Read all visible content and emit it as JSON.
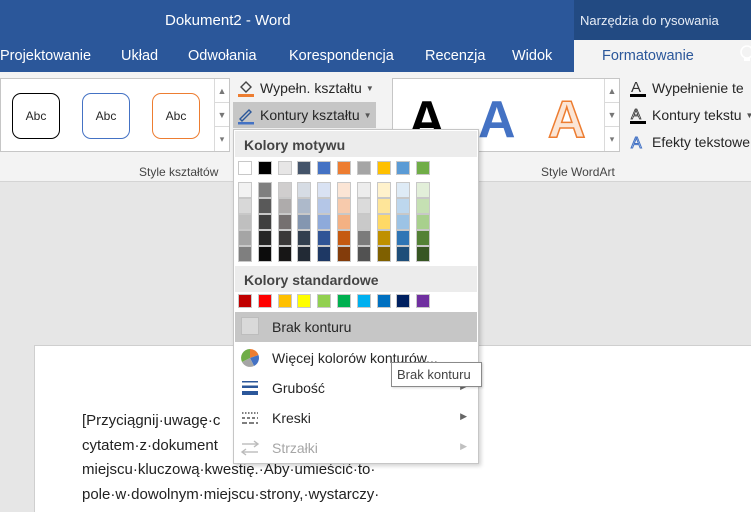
{
  "window": {
    "title": "Dokument2 - Word",
    "context_tab_group": "Narzędzia do rysowania"
  },
  "tabs": [
    {
      "label": "Projektowanie"
    },
    {
      "label": "Układ"
    },
    {
      "label": "Odwołania"
    },
    {
      "label": "Korespondencja"
    },
    {
      "label": "Recenzja"
    },
    {
      "label": "Widok"
    },
    {
      "label": "Formatowanie",
      "active": true
    }
  ],
  "ribbon": {
    "shape_styles": {
      "samples": [
        "Abc",
        "Abc",
        "Abc"
      ],
      "sample_colors": [
        "#000000",
        "#4472c4",
        "#ed7d31"
      ],
      "group_label": "Style kształtów",
      "fill_button": "Wypełn. kształtu",
      "outline_button": "Kontury kształtu"
    },
    "wordart": {
      "samples": [
        "A",
        "A",
        "A"
      ],
      "group_label": "Style WordArt",
      "text_fill": "Wypełnienie te",
      "text_outline": "Kontury tekstu",
      "text_effects": "Efekty tekstowe"
    }
  },
  "document": {
    "lines": [
      "[Przyciągnij·uwagę·c",
      "cytatem·z·dokument",
      "miejscu·kluczową·kwestię.·Aby·umieścić·to·",
      "pole·w·dowolnym·miejscu·strony,·wystarczy·"
    ]
  },
  "dropdown": {
    "theme_header": "Kolory motywu",
    "theme_top": [
      "#ffffff",
      "#000000",
      "#e7e6e6",
      "#44546a",
      "#4472c4",
      "#ed7d31",
      "#a5a5a5",
      "#ffc000",
      "#5b9bd5",
      "#70ad47"
    ],
    "theme_shades": [
      [
        "#f2f2f2",
        "#7f7f7f",
        "#d0cece",
        "#d6dce4",
        "#d9e2f3",
        "#fbe5d5",
        "#ededed",
        "#fff2cc",
        "#deebf6",
        "#e2efd9"
      ],
      [
        "#d8d8d8",
        "#595959",
        "#aeabab",
        "#adb9ca",
        "#b4c6e7",
        "#f7caac",
        "#dbdbdb",
        "#fee599",
        "#bdd7ee",
        "#c5e0b3"
      ],
      [
        "#bfbfbf",
        "#3f3f3f",
        "#757070",
        "#8496b0",
        "#8eaadb",
        "#f4b183",
        "#c9c9c9",
        "#ffd965",
        "#9cc3e5",
        "#a8d08d"
      ],
      [
        "#a5a5a5",
        "#262626",
        "#3a3838",
        "#323f4f",
        "#2f5496",
        "#c55a11",
        "#7b7b7b",
        "#bf9000",
        "#2e75b5",
        "#538135"
      ],
      [
        "#7f7f7f",
        "#0c0c0c",
        "#171616",
        "#222a35",
        "#1e3864",
        "#833c0b",
        "#525252",
        "#7f6000",
        "#1e4e79",
        "#375623"
      ]
    ],
    "standard_header": "Kolory standardowe",
    "standard_colors": [
      "#c00000",
      "#ff0000",
      "#ffc000",
      "#ffff00",
      "#92d050",
      "#00b050",
      "#00b0f0",
      "#0070c0",
      "#002060",
      "#7030a0"
    ],
    "items": {
      "no_outline": "Brak konturu",
      "more_colors": "Więcej kolorów konturów...",
      "weight": "Grubość",
      "dashes": "Kreski",
      "arrows": "Strzałki"
    }
  },
  "tooltip": {
    "text": "Brak konturu"
  }
}
